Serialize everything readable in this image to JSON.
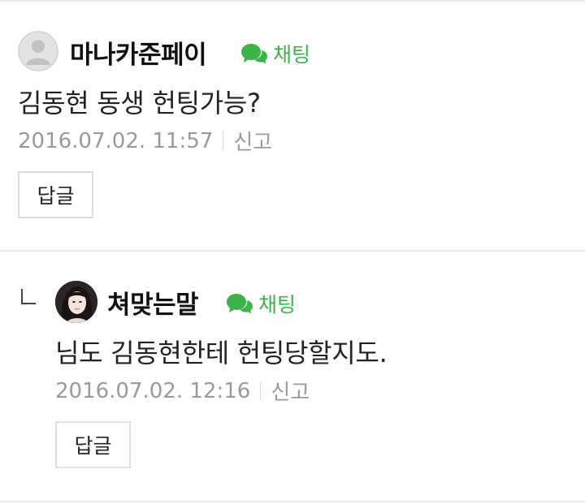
{
  "comments": [
    {
      "nickname": "마나카준페이",
      "chat_label": "채팅",
      "text": "김동현 동생 헌팅가능?",
      "timestamp": "2016.07.02. 11:57",
      "report_label": "신고",
      "reply_label": "답글",
      "avatar_icon": "default-user-icon"
    },
    {
      "nickname": "쳐맞는말",
      "chat_label": "채팅",
      "text": "님도 김동현한테 헌팅당할지도.",
      "timestamp": "2016.07.02. 12:16",
      "report_label": "신고",
      "reply_label": "답글",
      "avatar_icon": "profile-photo",
      "is_reply": true
    }
  ],
  "colors": {
    "chat_green": "#3cb44b",
    "meta_gray": "#9a9a9a",
    "divider": "#e9e9e9"
  }
}
